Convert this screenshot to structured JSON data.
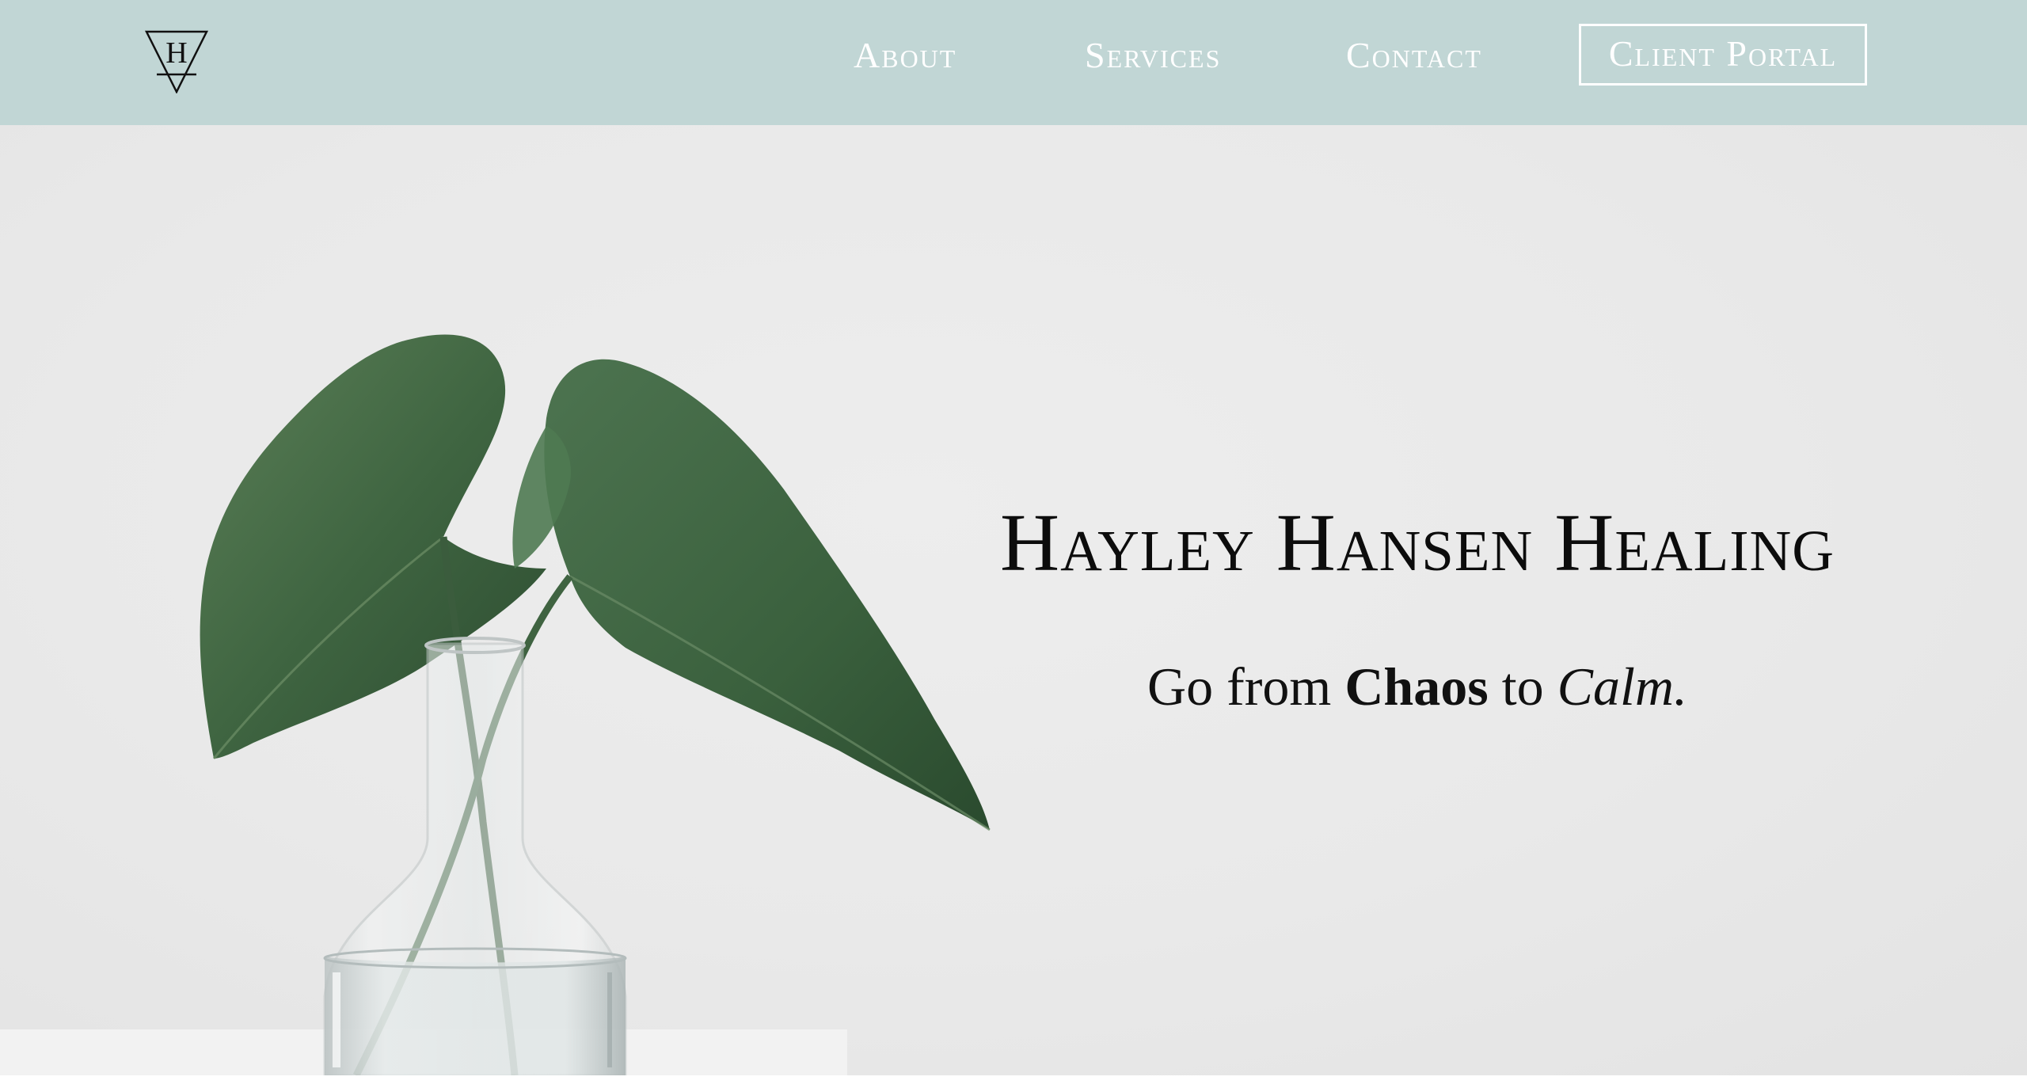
{
  "nav": {
    "logo_letter": "H",
    "links": {
      "about": "About",
      "services": "Services",
      "contact": "Contact"
    },
    "client_portal": "Client Portal",
    "background_color": "#c1d6d5"
  },
  "hero": {
    "title": "Hayley Hansen Healing",
    "tagline": {
      "part1": "Go from ",
      "emphasis_bold": "Chaos",
      "part2": " to ",
      "emphasis_italic": "Calm."
    },
    "background_color": "#eaeaea",
    "image_icon": "plant-in-vase-icon"
  }
}
